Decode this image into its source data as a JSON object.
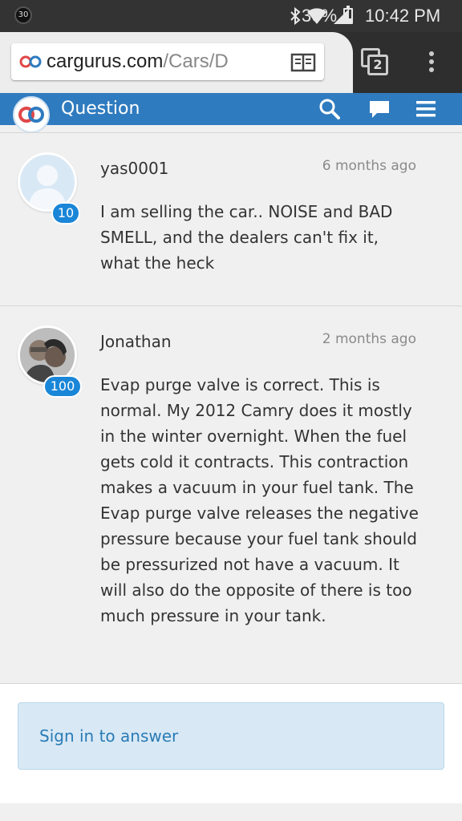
{
  "status_bar": {
    "notification_count": "30",
    "battery": "30%",
    "time": "10:42 PM"
  },
  "browser": {
    "url_host": "cargurus.com",
    "url_path": "/Cars/D",
    "tab_count": "2"
  },
  "header": {
    "title": "Question"
  },
  "comments": [
    {
      "author": "yas0001",
      "badge": "10",
      "time": "6 months ago",
      "text": "I am selling the car.. NOISE and BAD SMELL, and the dealers can't fix it, what the heck"
    },
    {
      "author": "Jonathan",
      "badge": "100",
      "time": "2 months ago",
      "text": "Evap purge valve is correct. This is normal. My 2012 Camry does it mostly in the winter overnight. When the fuel gets cold it contracts. This contraction makes a vacuum in your fuel tank. The Evap purge valve releases the negative pressure because your fuel tank should be pressurized not have a vacuum. It will also do the opposite of there is too much pressure in your tank."
    }
  ],
  "sign_in_label": "Sign in to answer",
  "colors": {
    "header_blue": "#2f7bbf",
    "badge_blue": "#1a86d8",
    "signin_bg": "#d8e9f5"
  }
}
